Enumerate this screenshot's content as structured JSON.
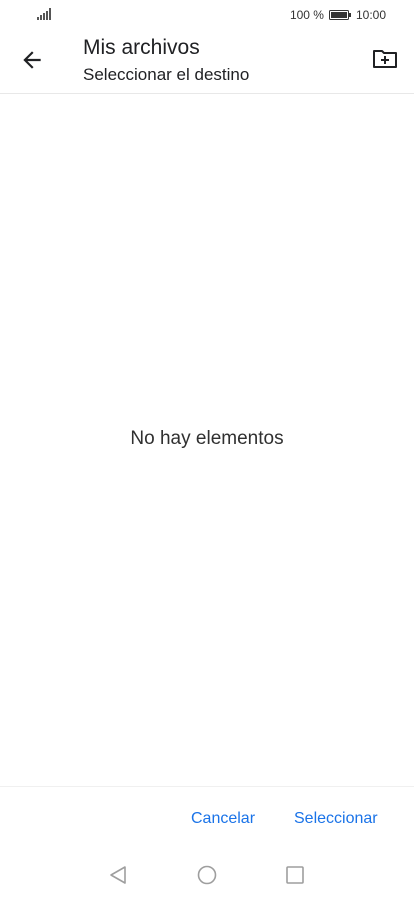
{
  "status_bar": {
    "battery_percent": "100 %",
    "time": "10:00",
    "signal_icon": "signal-icon",
    "battery_icon": "battery-icon",
    "battery_level": 1.0
  },
  "app_bar": {
    "title": "Mis archivos",
    "subtitle": "Seleccionar el destino",
    "back_icon": "arrow-left-icon",
    "new_folder_icon": "new-folder-icon"
  },
  "main": {
    "empty_message": "No hay elementos"
  },
  "actions": {
    "cancel_label": "Cancelar",
    "select_label": "Seleccionar"
  },
  "nav_bar": {
    "back_icon": "triangle-back-icon",
    "home_icon": "circle-home-icon",
    "recents_icon": "square-recents-icon"
  },
  "colors": {
    "accent": "#1a73e8",
    "text": "#202124",
    "nav_icons": "#9e9e9e"
  }
}
